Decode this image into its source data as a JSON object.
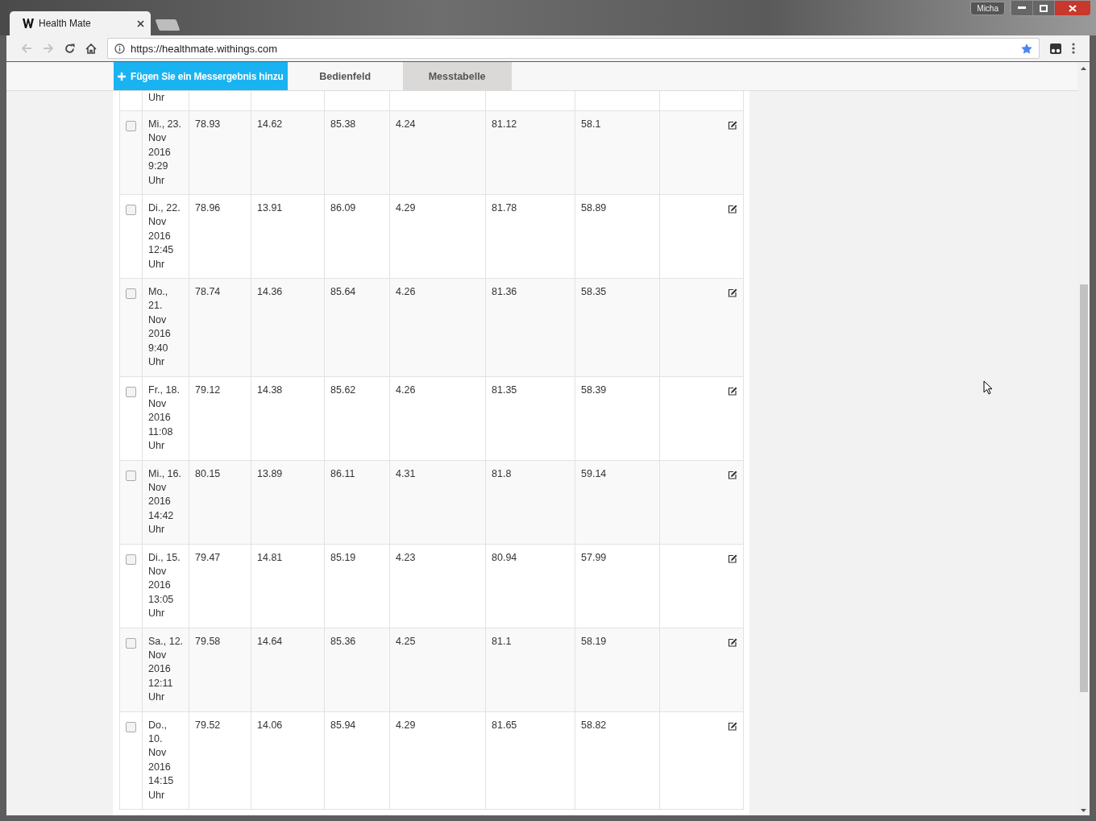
{
  "browser": {
    "tab_title": "Health Mate",
    "profile": "Micha",
    "address": "https://healthmate.withings.com"
  },
  "header": {
    "add_button": "Fügen Sie ein Messergebnis hinzu",
    "tabs": [
      {
        "label": "Bedienfeld",
        "selected": false
      },
      {
        "label": "Messtabelle",
        "selected": true
      }
    ]
  },
  "table": {
    "rows": [
      {
        "kind": "partial",
        "date": "Uhr"
      },
      {
        "kind": "full",
        "checked": false,
        "date": "Mi., 23.\nNov\n2016\n9:29\nUhr",
        "values": [
          "78.93",
          "14.62",
          "85.38",
          "4.24",
          "81.12",
          "58.1"
        ]
      },
      {
        "kind": "full",
        "checked": false,
        "date": "Di., 22.\nNov\n2016\n12:45\nUhr",
        "values": [
          "78.96",
          "13.91",
          "86.09",
          "4.29",
          "81.78",
          "58.89"
        ]
      },
      {
        "kind": "full",
        "checked": false,
        "date": "Mo.,\n21.\nNov\n2016\n9:40\nUhr",
        "values": [
          "78.74",
          "14.36",
          "85.64",
          "4.26",
          "81.36",
          "58.35"
        ]
      },
      {
        "kind": "full",
        "checked": false,
        "date": "Fr., 18.\nNov\n2016\n11:08\nUhr",
        "values": [
          "79.12",
          "14.38",
          "85.62",
          "4.26",
          "81.35",
          "58.39"
        ]
      },
      {
        "kind": "full",
        "checked": false,
        "date": "Mi., 16.\nNov\n2016\n14:42\nUhr",
        "values": [
          "80.15",
          "13.89",
          "86.11",
          "4.31",
          "81.8",
          "59.14"
        ]
      },
      {
        "kind": "full",
        "checked": false,
        "date": "Di., 15.\nNov\n2016\n13:05\nUhr",
        "values": [
          "79.47",
          "14.81",
          "85.19",
          "4.23",
          "80.94",
          "57.99"
        ]
      },
      {
        "kind": "full",
        "checked": false,
        "date": "Sa., 12.\nNov\n2016\n12:11\nUhr",
        "values": [
          "79.58",
          "14.64",
          "85.36",
          "4.25",
          "81.1",
          "58.19"
        ]
      },
      {
        "kind": "full",
        "checked": false,
        "date": "Do.,\n10.\nNov\n2016\n14:15\nUhr",
        "values": [
          "79.52",
          "14.06",
          "85.94",
          "4.29",
          "81.65",
          "58.82"
        ]
      }
    ]
  }
}
